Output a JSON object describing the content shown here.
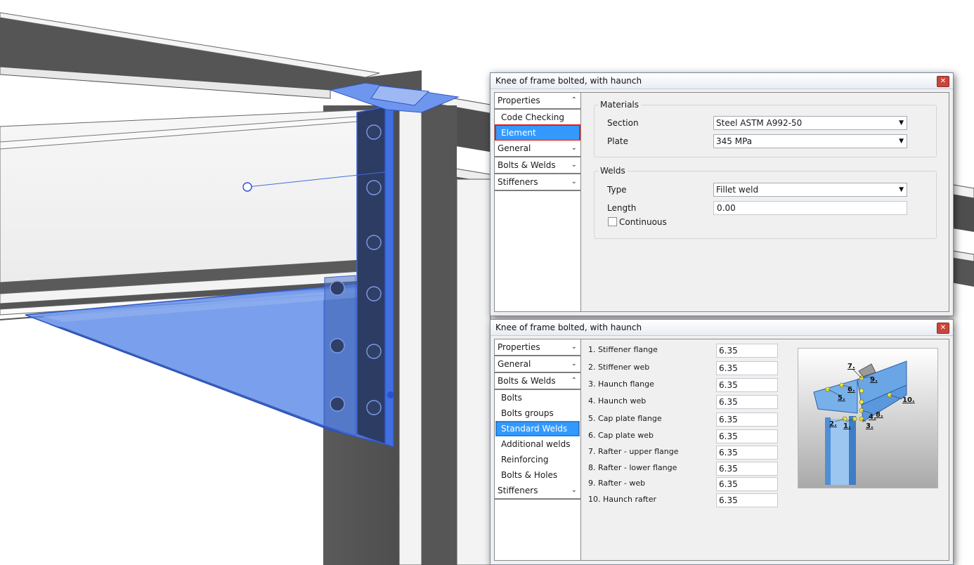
{
  "dialog_top": {
    "title": "Knee of frame bolted, with haunch",
    "close_glyph": "✕",
    "nav": {
      "properties_header": "Properties",
      "code_checking": "Code Checking",
      "element_properties": "Element Properties",
      "general_header": "General",
      "bolts_welds_header": "Bolts & Welds",
      "stiffeners_header": "Stiffeners"
    },
    "materials": {
      "group_label": "Materials",
      "section_label": "Section",
      "section_value": "Steel ASTM A992-50",
      "plate_label": "Plate",
      "plate_value": "345 MPa"
    },
    "welds": {
      "group_label": "Welds",
      "type_label": "Type",
      "type_value": "Fillet weld",
      "length_label": "Length",
      "length_value": "0.00",
      "continuous_label": "Continuous"
    }
  },
  "dialog_bottom": {
    "title": "Knee of frame bolted, with haunch",
    "close_glyph": "✕",
    "nav": {
      "properties_header": "Properties",
      "general_header": "General",
      "bolts_welds_header": "Bolts & Welds",
      "bolts": "Bolts",
      "bolts_groups": "Bolts groups",
      "standard_welds": "Standard Welds",
      "additional_welds": "Additional welds",
      "reinforcing": "Reinforcing",
      "bolts_holes": "Bolts & Holes",
      "stiffeners_header": "Stiffeners"
    },
    "welds": [
      {
        "label": "1. Stiffener flange",
        "value": "6.35"
      },
      {
        "label": "2. Stiffener web",
        "value": "6.35"
      },
      {
        "label": "3. Haunch flange",
        "value": "6.35"
      },
      {
        "label": "4. Haunch web",
        "value": "6.35"
      },
      {
        "label": "5. Cap plate flange",
        "value": "6.35"
      },
      {
        "label": "6. Cap plate web",
        "value": "6.35"
      },
      {
        "label": "7. Rafter - upper flange",
        "value": "6.35"
      },
      {
        "label": "8. Rafter - lower flange",
        "value": "6.35"
      },
      {
        "label": "9. Rafter - web",
        "value": "6.35"
      },
      {
        "label": "10. Haunch rafter",
        "value": "6.35"
      }
    ],
    "figure_labels": {
      "n1": "1.",
      "n2": "2.",
      "n3": "3.",
      "n4": "4.",
      "n5": "5.",
      "n6": "6.",
      "n7": "7.",
      "n8": "8.",
      "n9": "9.",
      "n10": "10."
    }
  },
  "glyphs": {
    "chev_up": "⌃",
    "chev_down": "⌄",
    "combo_arrow": "▼"
  },
  "colors": {
    "selection_blue": "#3399ff",
    "highlight_red": "#e31b1b",
    "selected_model_blue": "#3f6fe0"
  }
}
